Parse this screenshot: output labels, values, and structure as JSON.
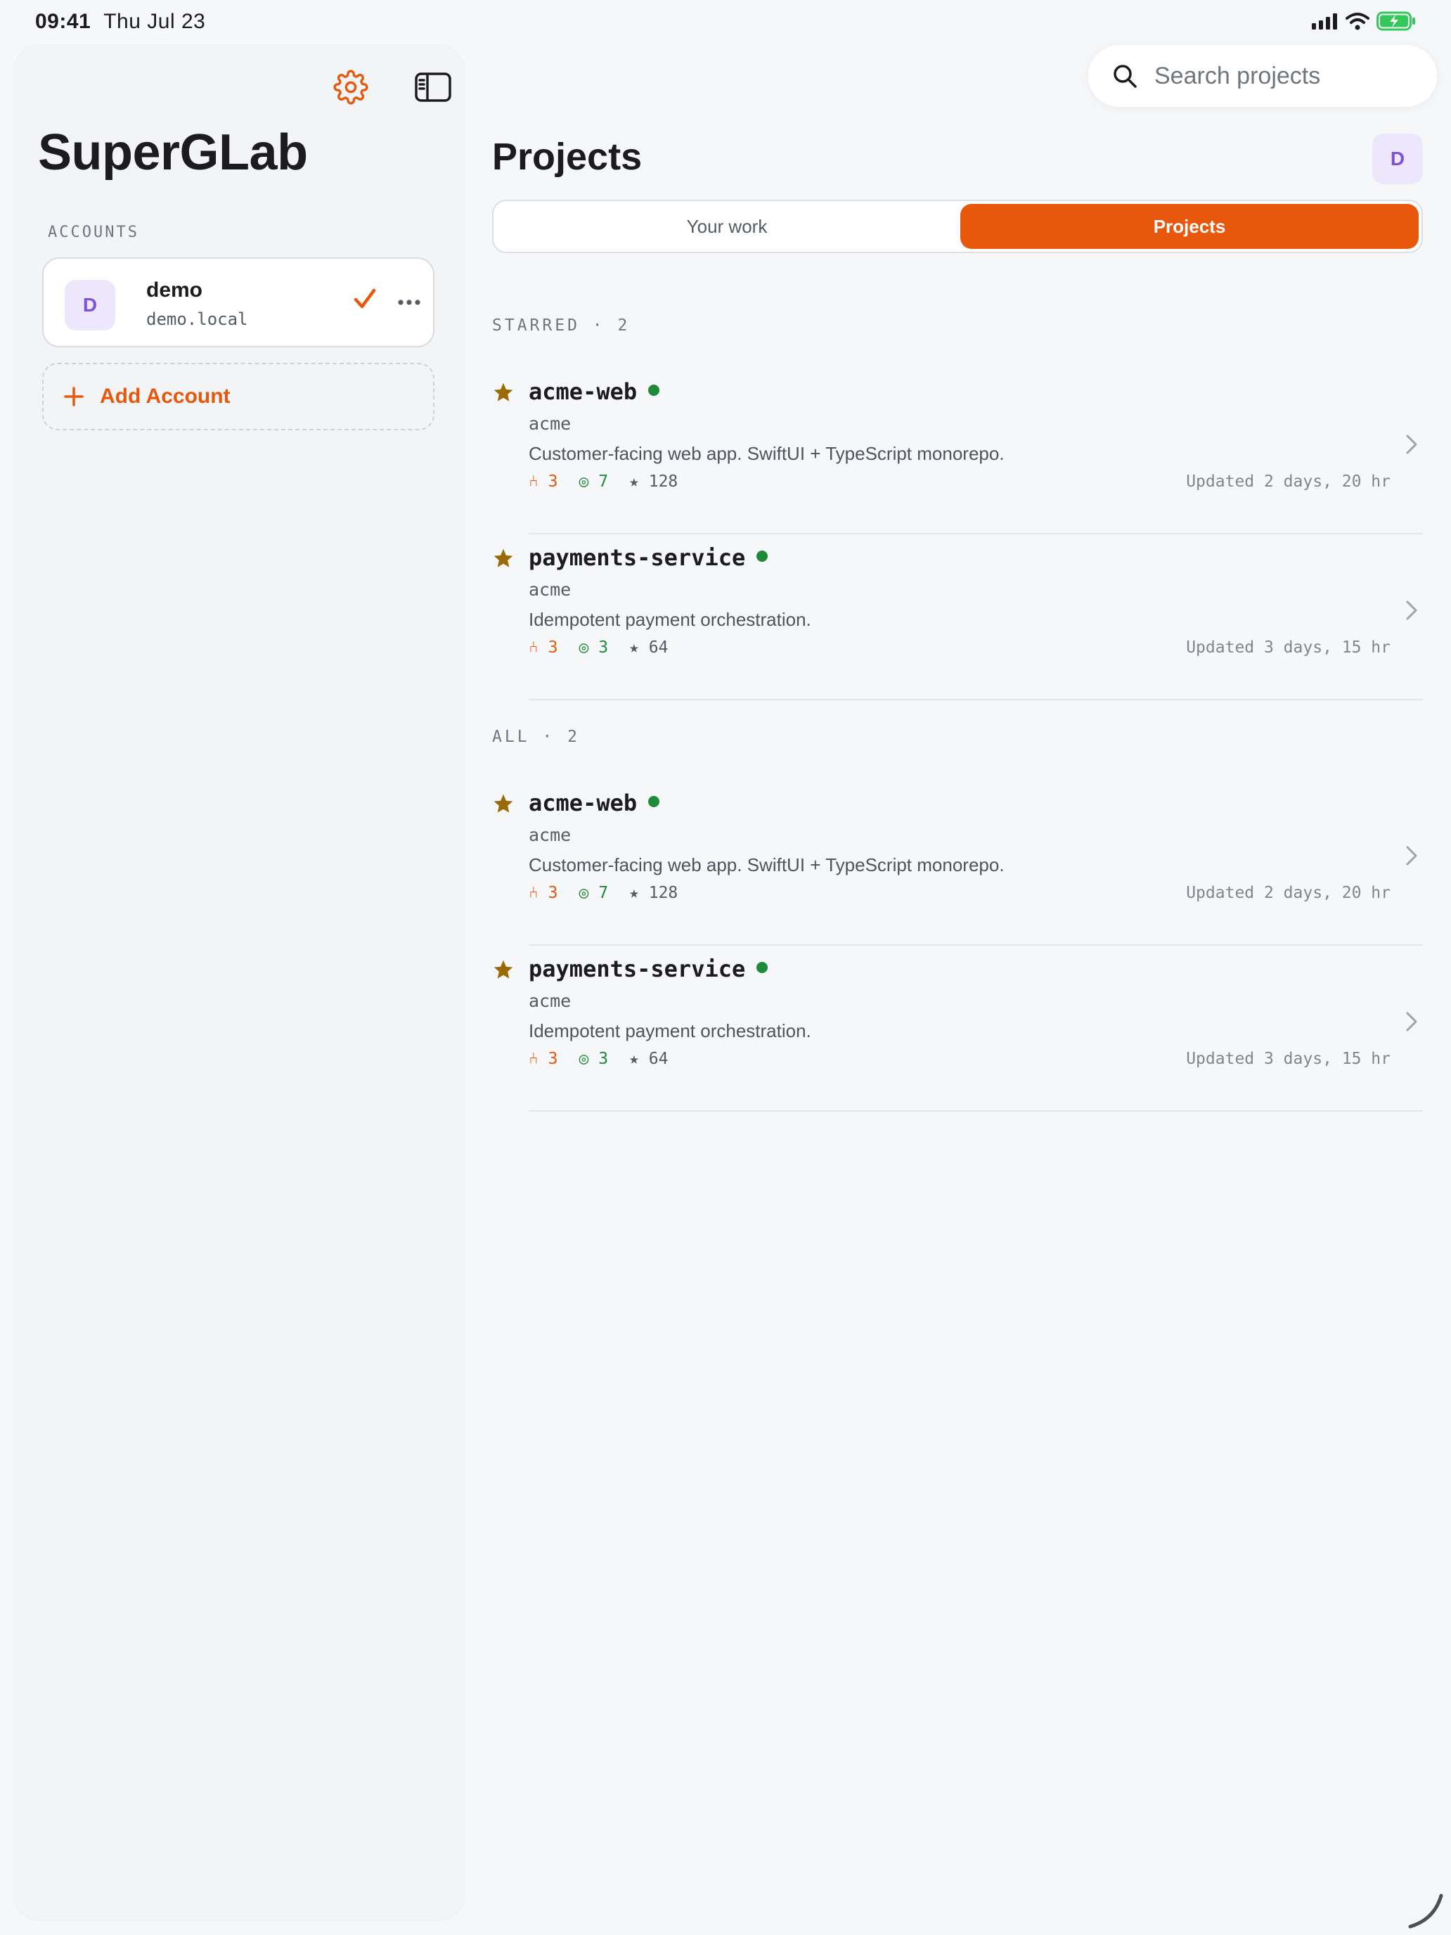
{
  "status_bar": {
    "time": "09:41",
    "date": "Thu Jul 23"
  },
  "sidebar": {
    "app_title": "SuperGLab",
    "accounts_label": "ACCOUNTS",
    "account": {
      "avatar_letter": "D",
      "name": "demo",
      "host": "demo.local"
    },
    "add_account_label": "Add Account"
  },
  "search": {
    "placeholder": "Search projects"
  },
  "main": {
    "title": "Projects",
    "user_avatar_letter": "D",
    "tabs": [
      {
        "label": "Your work"
      },
      {
        "label": "Projects"
      }
    ],
    "selected_tab": "Projects",
    "sections": [
      {
        "label": "STARRED · 2",
        "projects": [
          {
            "name": "acme-web",
            "namespace": "acme",
            "description": "Customer-facing web app. SwiftUI + TypeScript monorepo.",
            "merge_requests": "⑃ 3",
            "issues": "◎ 7",
            "stars": "★ 128",
            "updated": "Updated 2 days, 20 hr"
          },
          {
            "name": "payments-service",
            "namespace": "acme",
            "description": "Idempotent payment orchestration.",
            "merge_requests": "⑃ 3",
            "issues": "◎ 3",
            "stars": "★ 64",
            "updated": "Updated 3 days, 15 hr"
          }
        ]
      },
      {
        "label": "ALL · 2",
        "projects": [
          {
            "name": "acme-web",
            "namespace": "acme",
            "description": "Customer-facing web app. SwiftUI + TypeScript monorepo.",
            "merge_requests": "⑃ 3",
            "issues": "◎ 7",
            "stars": "★ 128",
            "updated": "Updated 2 days, 20 hr"
          },
          {
            "name": "payments-service",
            "namespace": "acme",
            "description": "Idempotent payment orchestration.",
            "merge_requests": "⑃ 3",
            "issues": "◎ 3",
            "stars": "★ 64",
            "updated": "Updated 3 days, 15 hr"
          }
        ]
      }
    ]
  },
  "colors": {
    "accent": "#e8580c",
    "star": "#9a6a06",
    "status_green": "#1f8a3a",
    "avatar_bg": "#ede7fb",
    "avatar_fg": "#7d52d8"
  }
}
